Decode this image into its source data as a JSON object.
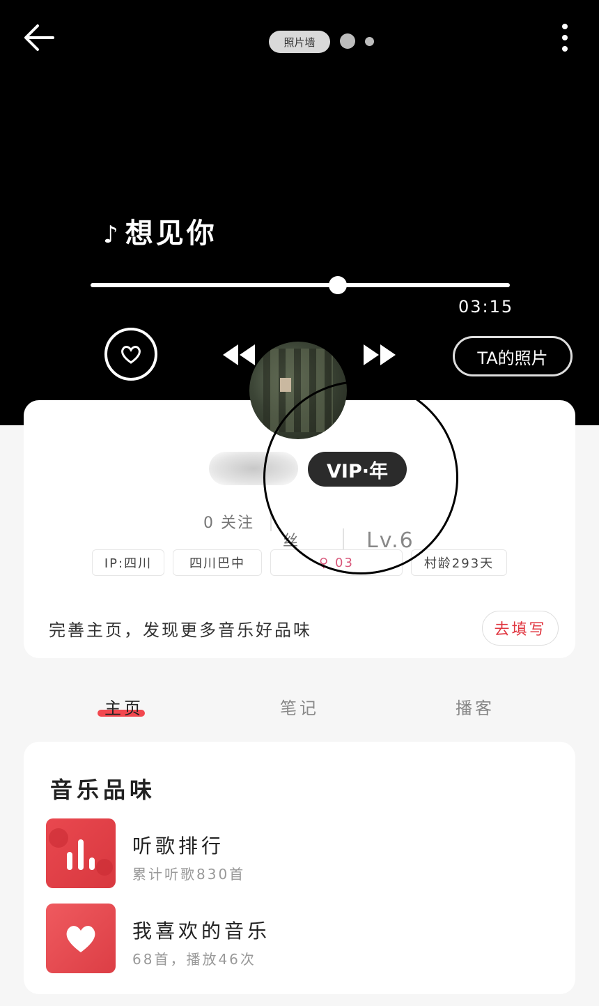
{
  "header": {
    "photo_wall_label": "照片墙",
    "song_title": "想见你",
    "song_note_icon": "music-note-icon",
    "time": "03:15",
    "progress_fraction": 0.59,
    "ta_photo_label": "TA的照片"
  },
  "profile": {
    "vip_label": "VIP·年",
    "follow_text": "0 关注",
    "fans_text": "丝",
    "level_text": "Lv.6",
    "tags": [
      "IP:四川",
      "四川巴中",
      "♀ 03",
      "村龄293天"
    ],
    "prompt_text": "完善主页，发现更多音乐好品味",
    "fill_button": "去填写"
  },
  "tabs": [
    {
      "label": "主页",
      "active": true
    },
    {
      "label": "笔记",
      "active": false
    },
    {
      "label": "播客",
      "active": false
    }
  ],
  "music_taste": {
    "title": "音乐品味",
    "items": [
      {
        "title": "听歌排行",
        "subtitle": "累计听歌830首",
        "icon": "ranking-bars-icon"
      },
      {
        "title": "我喜欢的音乐",
        "subtitle": "68首，播放46次",
        "icon": "heart-icon"
      }
    ]
  },
  "colors": {
    "accent_red": "#e0353f",
    "header_bg": "#000000",
    "page_bg": "#f6f6f6"
  }
}
